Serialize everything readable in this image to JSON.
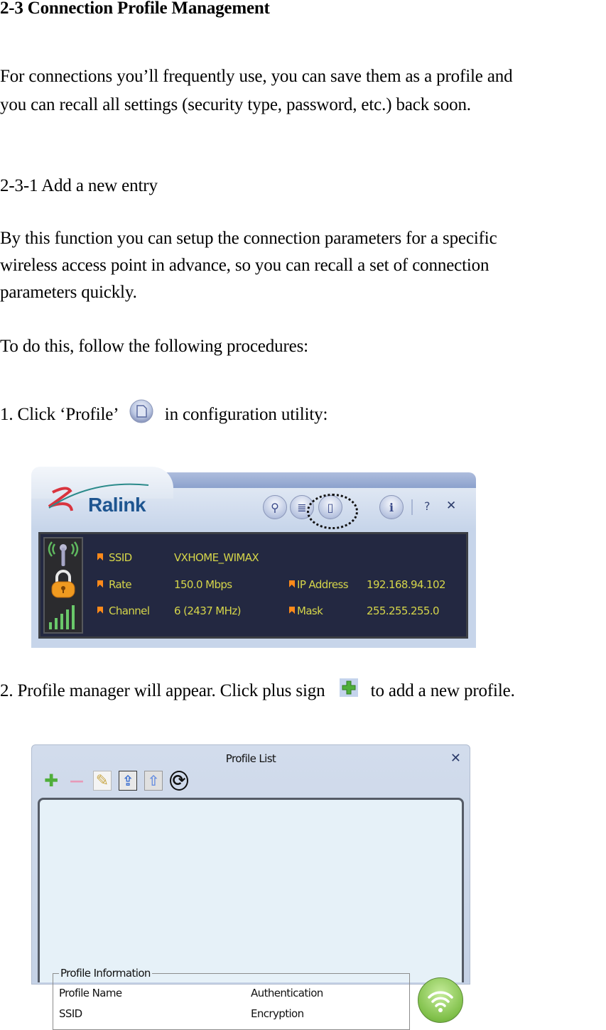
{
  "heading": "2-3 Connection Profile Management",
  "intro": {
    "line1": "For connections you’ll frequently use, you can save them as a profile and",
    "line2": "you can recall all settings (security type, password, etc.) back soon."
  },
  "subheading": "2-3-1 Add a new entry",
  "description": {
    "line1": "By this function you can setup the connection parameters for a specific",
    "line2": "wireless access point in advance, so you can recall a set of connection",
    "line3": "parameters quickly."
  },
  "procedure_intro": "To do this, follow the following procedures:",
  "steps": [
    {
      "prefix": "1.  Click ‘Profile’",
      "icon": "profile-icon",
      "suffix": "in configuration utility:"
    },
    {
      "prefix": "2.  Profile manager will appear. Click plus sign",
      "icon": "plus-icon",
      "suffix": "to add a new profile."
    }
  ],
  "ralink_window": {
    "logo": "Ralink",
    "toolbar": [
      {
        "icon": "search-icon",
        "glyph": "⚲"
      },
      {
        "icon": "list-icon",
        "glyph": "≣"
      },
      {
        "icon": "profile-icon",
        "glyph": "▯"
      },
      {
        "icon": "info-icon",
        "glyph": "i"
      }
    ],
    "help_label": "?",
    "close_label": "✕",
    "status": {
      "ssid_label": "SSID",
      "ssid_value": "VXHOME_WIMAX",
      "rate_label": "Rate",
      "rate_value": "150.0 Mbps",
      "channel_label": "Channel",
      "channel_value": "6 (2437 MHz)",
      "ip_label": "IP Address",
      "ip_value": "192.168.94.102",
      "mask_label": "Mask",
      "mask_value": "255.255.255.0"
    },
    "colors": {
      "panel": "#232841",
      "text": "#d5d54a",
      "bullet": "#ff8a1a"
    }
  },
  "profile_window": {
    "title": "Profile List",
    "close_label": "✕",
    "toolbar": [
      {
        "icon": "add-icon",
        "glyph": "✚"
      },
      {
        "icon": "remove-icon",
        "glyph": "—"
      },
      {
        "icon": "edit-icon",
        "glyph": "✎"
      },
      {
        "icon": "import-icon",
        "glyph": "⇪"
      },
      {
        "icon": "export-icon",
        "glyph": "⇧"
      },
      {
        "icon": "activate-icon",
        "glyph": "⟳"
      }
    ],
    "info_group": "Profile Information",
    "fields": {
      "profile_name": "Profile Name",
      "ssid": "SSID",
      "authentication": "Authentication",
      "encryption": "Encryption"
    }
  }
}
